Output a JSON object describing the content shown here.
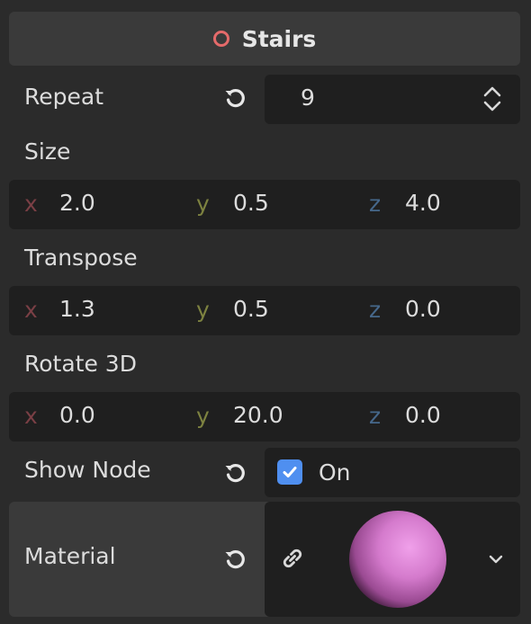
{
  "header": {
    "title": "Stairs",
    "icon": "node-circle-icon",
    "icon_color": "#e46a6a"
  },
  "repeat": {
    "label": "Repeat",
    "value": "9"
  },
  "size": {
    "label": "Size",
    "x": "2.0",
    "y": "0.5",
    "z": "4.0"
  },
  "transpose": {
    "label": "Transpose",
    "x": "1.3",
    "y": "0.5",
    "z": "0.0"
  },
  "rotate": {
    "label": "Rotate 3D",
    "x": "0.0",
    "y": "20.0",
    "z": "0.0"
  },
  "show_node": {
    "label": "Show Node",
    "checked": true,
    "state_text": "On"
  },
  "material": {
    "label": "Material",
    "preview_color": "#e08ad8"
  },
  "axis_labels": {
    "x": "x",
    "y": "y",
    "z": "z"
  },
  "colors": {
    "axis_x": "#7a3f45",
    "axis_y": "#7d8240",
    "axis_z": "#46688b",
    "checkbox": "#4f8ff0"
  }
}
